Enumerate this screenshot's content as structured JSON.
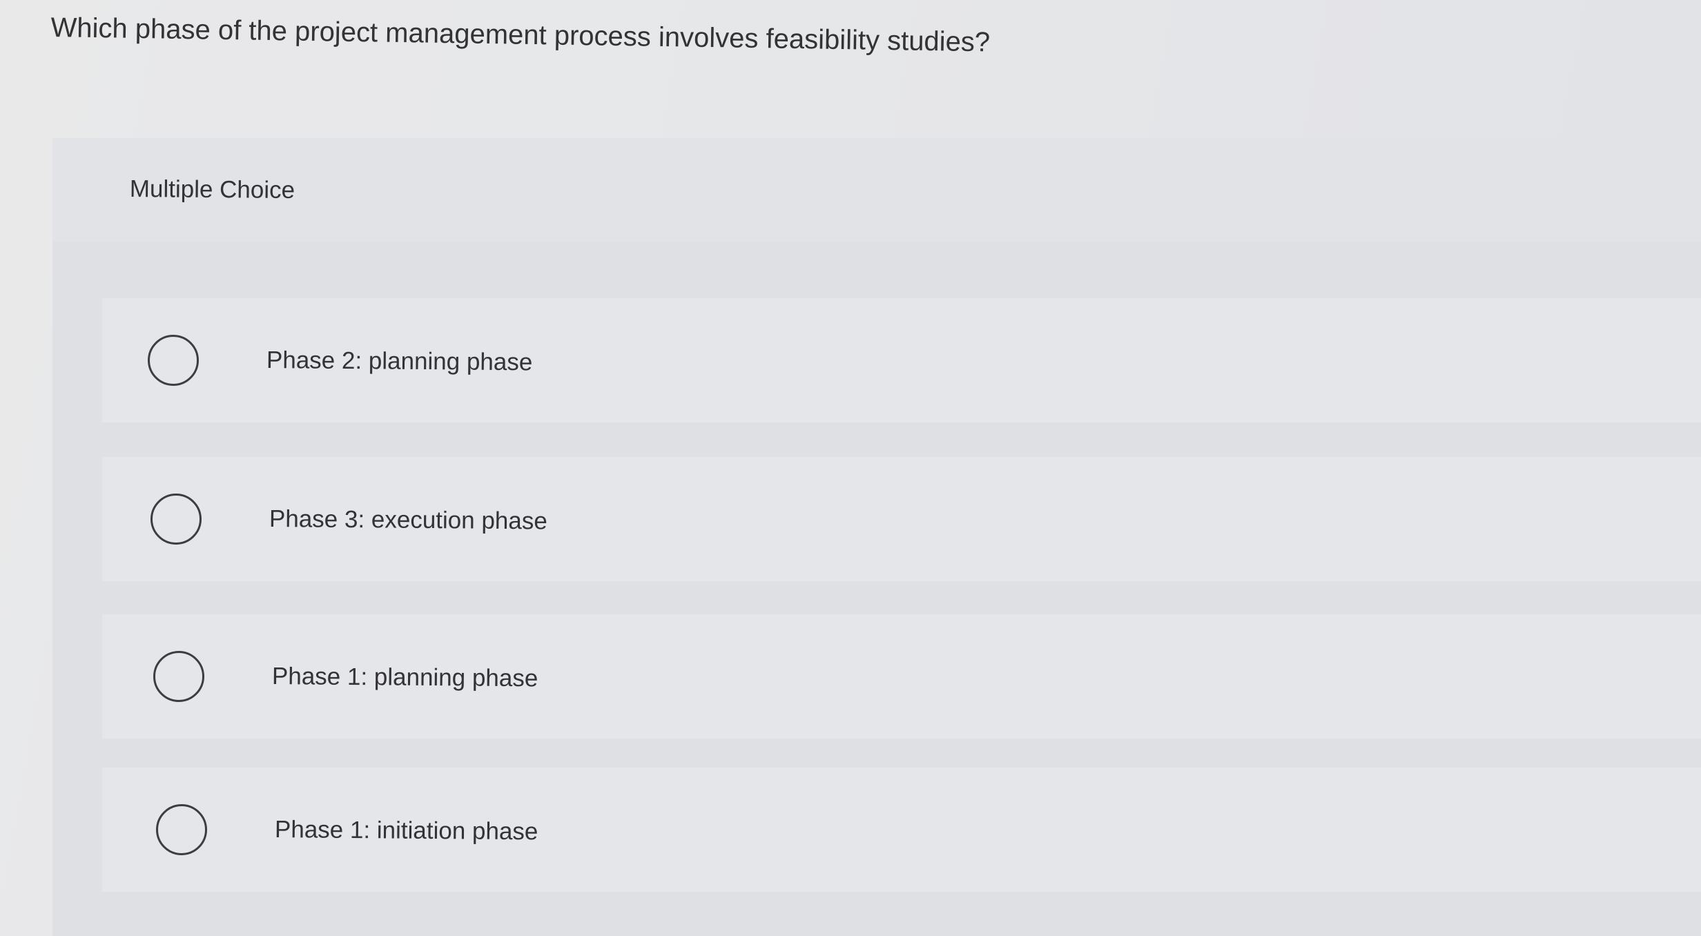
{
  "question": {
    "text": "Which phase of the project management process involves feasibility studies?"
  },
  "quiz": {
    "type_label": "Multiple Choice",
    "options": [
      {
        "label": "Phase 2: planning phase",
        "selected": false
      },
      {
        "label": "Phase 3: execution phase",
        "selected": false
      },
      {
        "label": "Phase 1: planning phase",
        "selected": false
      },
      {
        "label": "Phase 1: initiation phase",
        "selected": false
      }
    ]
  },
  "colors": {
    "background": "#e6e7e9",
    "panel": "#dfe0e3",
    "option_row": "#e5e6e9",
    "text": "#333336",
    "radio_border": "#3d3d40"
  }
}
